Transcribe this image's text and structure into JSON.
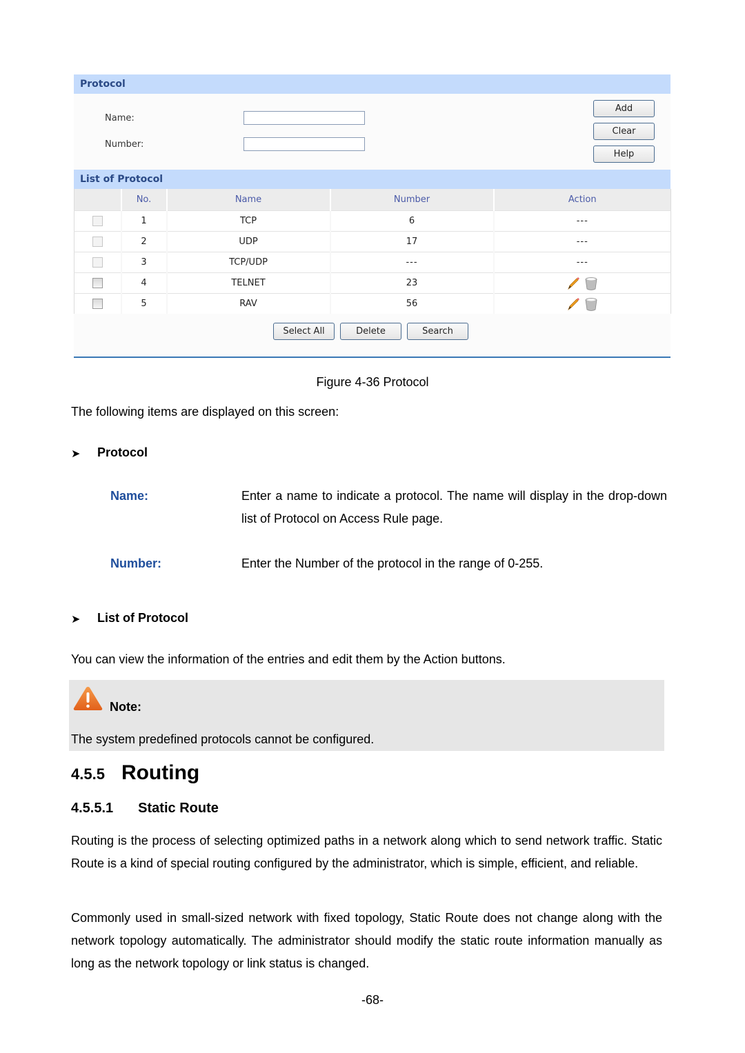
{
  "figure": {
    "protocol_panel": {
      "title": "Protocol",
      "name_label": "Name:",
      "name_value": "",
      "number_label": "Number:",
      "number_value": "",
      "buttons": {
        "add": "Add",
        "clear": "Clear",
        "help": "Help"
      }
    },
    "list_panel": {
      "title": "List of Protocol",
      "columns": [
        "",
        "No.",
        "Name",
        "Number",
        "Action"
      ],
      "rows": [
        {
          "no": "1",
          "name": "TCP",
          "number": "6",
          "action": "---",
          "editable": false
        },
        {
          "no": "2",
          "name": "UDP",
          "number": "17",
          "action": "---",
          "editable": false
        },
        {
          "no": "3",
          "name": "TCP/UDP",
          "number": "---",
          "action": "---",
          "editable": false
        },
        {
          "no": "4",
          "name": "TELNET",
          "number": "23",
          "action": "edit-delete",
          "editable": true
        },
        {
          "no": "5",
          "name": "RAV",
          "number": "56",
          "action": "edit-delete",
          "editable": true
        }
      ],
      "buttons": {
        "select_all": "Select All",
        "delete": "Delete",
        "search": "Search"
      }
    }
  },
  "caption": "Figure 4-36 Protocol",
  "intro": "The following items are displayed on this screen:",
  "sections": {
    "protocol": {
      "heading": "Protocol",
      "items": [
        {
          "term": "Name:",
          "desc": "Enter a name to indicate a protocol. The name will display in the drop-down list of Protocol on Access Rule page."
        },
        {
          "term": "Number:",
          "desc": "Enter the Number of the protocol in the range of 0-255."
        }
      ]
    },
    "list": {
      "heading": "List of Protocol",
      "text": "You can view the information of the entries and edit them by the Action buttons."
    }
  },
  "note": {
    "icon": "warning-icon",
    "title": "Note:",
    "text": "The system predefined protocols cannot be configured."
  },
  "heading_h2": {
    "number": "4.5.5",
    "title": "Routing"
  },
  "heading_h3": {
    "number": "4.5.5.1",
    "title": "Static Route"
  },
  "paragraphs": [
    "Routing is the process of selecting optimized paths in a network along which to send network traffic. Static Route is a kind of special routing configured by the administrator, which is simple, efficient, and reliable.",
    "Commonly used in small-sized network with fixed topology, Static Route does not change along with the network topology automatically. The administrator should modify the static route information manually as long as the network topology or link status is changed."
  ],
  "page_number": "-68-",
  "colors": {
    "panel_header": "#c4dbfc",
    "term_blue": "#1f4e9c",
    "note_bg": "#e6e6e6",
    "footer_rule": "#3a78b5"
  }
}
